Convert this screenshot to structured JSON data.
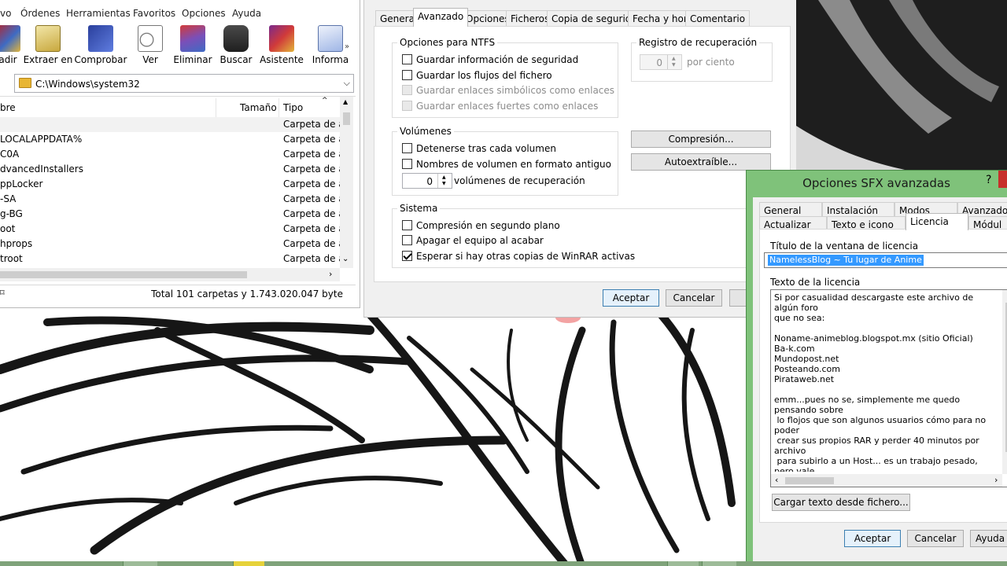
{
  "winrar": {
    "menu": [
      "vo",
      "Órdenes",
      "Herramientas",
      "Favoritos",
      "Opciones",
      "Ayuda"
    ],
    "toolbar": [
      {
        "label": "adir",
        "icon": "add-archive-icon"
      },
      {
        "label": "Extraer en",
        "icon": "extract-icon"
      },
      {
        "label": "Comprobar",
        "icon": "test-icon"
      },
      {
        "label": "Ver",
        "icon": "view-icon"
      },
      {
        "label": "Eliminar",
        "icon": "delete-icon"
      },
      {
        "label": "Buscar",
        "icon": "find-icon"
      },
      {
        "label": "Asistente",
        "icon": "wizard-icon"
      },
      {
        "label": "Informa",
        "icon": "info-icon"
      }
    ],
    "toolbar_more": "»",
    "path": "C:\\Windows\\system32",
    "columns": {
      "name": "bre",
      "size": "Tamaño",
      "type": "Tipo"
    },
    "files": [
      {
        "name": "",
        "type": "Carpeta de ar"
      },
      {
        "name": "LOCALAPPDATA%",
        "type": "Carpeta de ar"
      },
      {
        "name": "C0A",
        "type": "Carpeta de ar"
      },
      {
        "name": "dvancedInstallers",
        "type": "Carpeta de ar"
      },
      {
        "name": "ppLocker",
        "type": "Carpeta de ar"
      },
      {
        "name": "-SA",
        "type": "Carpeta de ar"
      },
      {
        "name": "g-BG",
        "type": "Carpeta de ar"
      },
      {
        "name": "oot",
        "type": "Carpeta de ar"
      },
      {
        "name": "hprops",
        "type": "Carpeta de ar"
      },
      {
        "name": "troot",
        "type": "Carpeta de ar"
      }
    ],
    "status": "Total 101 carpetas y 1.743.020.047 byte"
  },
  "archive_dialog": {
    "tabs": [
      "General",
      "Avanzado",
      "Opciones",
      "Ficheros",
      "Copia de seguridad",
      "Fecha y hora",
      "Comentario"
    ],
    "active_tab": "Avanzado",
    "ntfs": {
      "title": "Opciones para NTFS",
      "items": [
        {
          "label": "Guardar información de seguridad",
          "checked": false,
          "disabled": false
        },
        {
          "label": "Guardar los flujos del fichero",
          "checked": false,
          "disabled": false
        },
        {
          "label": "Guardar enlaces simbólicos como enlaces",
          "checked": false,
          "disabled": true
        },
        {
          "label": "Guardar enlaces fuertes como enlaces",
          "checked": false,
          "disabled": true
        }
      ]
    },
    "recovery": {
      "title": "Registro de recuperación",
      "value": "0",
      "unit": "por ciento"
    },
    "volumes": {
      "title": "Volúmenes",
      "items": [
        {
          "label": "Detenerse tras cada volumen",
          "checked": false
        },
        {
          "label": "Nombres de volumen en formato antiguo",
          "checked": false
        }
      ],
      "recovery_volumes_value": "0",
      "recovery_volumes_label": "volúmenes de recuperación"
    },
    "compression_button": "Compresión...",
    "sfx_button": "Autoextraíble...",
    "system": {
      "title": "Sistema",
      "items": [
        {
          "label": "Compresión en segundo plano",
          "checked": false
        },
        {
          "label": "Apagar el equipo al acabar",
          "checked": false
        },
        {
          "label": "Esperar si hay otras copias de WinRAR activas",
          "checked": true
        }
      ]
    },
    "ok": "Aceptar",
    "cancel": "Cancelar"
  },
  "sfx_dialog": {
    "title": "Opciones SFX avanzadas",
    "help": "?",
    "tabs_row1": [
      "General",
      "Instalación",
      "Modos",
      "Avanzado"
    ],
    "tabs_row2": [
      "Actualizar",
      "Texto e icono",
      "Licencia",
      "Módul"
    ],
    "active_tab": "Licencia",
    "license_title_label": "Título de la ventana de licencia",
    "license_title_value": "NamelessBlog ~ Tu lugar de Anime",
    "license_text_label": "Texto de la licencia",
    "license_text": "Si por casualidad descargaste este archivo de algún foro\nque no sea:\n\nNoname-animeblog.blogspot.mx (sitio Oficial)\nBa-k.com\nMundopost.net\nPosteando.com\nPirataweb.net\n\nemm...pues no se, simplemente me quedo pensando sobre\n lo flojos que son algunos usuarios cómo para no poder\n crear sus propios RAR y perder 40 minutos por archivo\n para subirlo a un Host... es un trabajo pesado, pero vale\n la pena el compartir...\n\n{ByEvlon}",
    "load_button": "Cargar texto desde fichero...",
    "ok": "Aceptar",
    "cancel": "Cancelar",
    "help_button": "Ayuda"
  },
  "colors": {
    "sfx_frame": "#7fc27a",
    "selection": "#3399ff",
    "close_button": "#c7302b"
  }
}
